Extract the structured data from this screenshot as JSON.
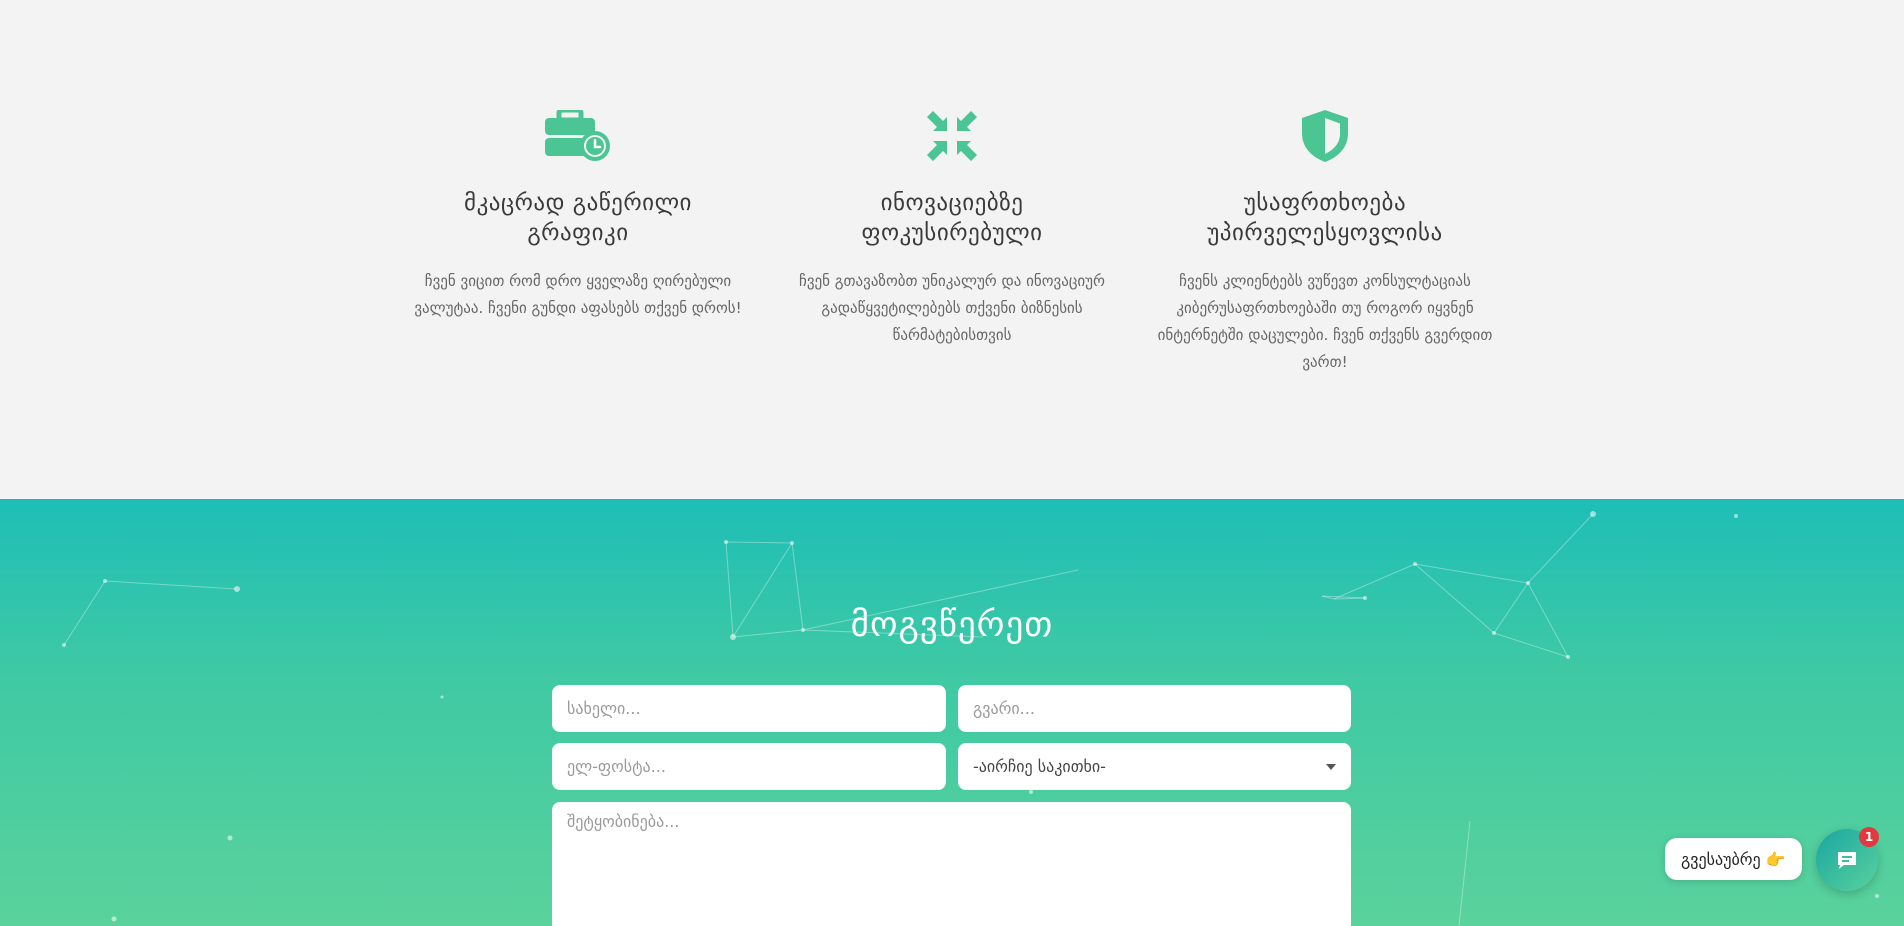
{
  "features": [
    {
      "icon": "briefcase-clock-icon",
      "title_line1": "მკაცრად გაწერილი",
      "title_line2": "გრაფიკი",
      "description": "ჩვენ ვიცით რომ დრო ყველაზე ღირებული ვალუტაა. ჩვენი გუნდი აფასებს თქვენ დროს!"
    },
    {
      "icon": "compress-arrows-icon",
      "title_line1": "ინოვაციებზე",
      "title_line2": "ფოკუსირებული",
      "description": "ჩვენ გთავაზობთ უნიკალურ და ინოვაციურ გადაწყვეტილებებს თქვენი ბიზნესის წარმატებისთვის"
    },
    {
      "icon": "shield-icon",
      "title_line1": "უსაფრთხოება",
      "title_line2": "უპირველესყოვლისა",
      "description": "ჩვენს კლიენტებს ვუწევთ კონსულტაციას კიბერუსაფრთხოებაში თუ როგორ იყვნენ ინტერნეტში დაცულები. ჩვენ თქვენს გვერდით ვართ!"
    }
  ],
  "contact": {
    "title": "მოგვწერეთ",
    "first_name_placeholder": "სახელი...",
    "last_name_placeholder": "გვარი...",
    "email_placeholder": "ელ-ფოსტა...",
    "topic_selected": "-აირჩიე საკითხი-",
    "message_placeholder": "შეტყობინება..."
  },
  "chat": {
    "label": "გვესაუბრე 👉",
    "badge_count": "1",
    "icon": "chat-bubble-icon"
  },
  "colors": {
    "accent": "#4cc594",
    "gradient_top": "#1ebeb7",
    "gradient_bottom": "#5ad29c",
    "badge": "#e0393e"
  }
}
